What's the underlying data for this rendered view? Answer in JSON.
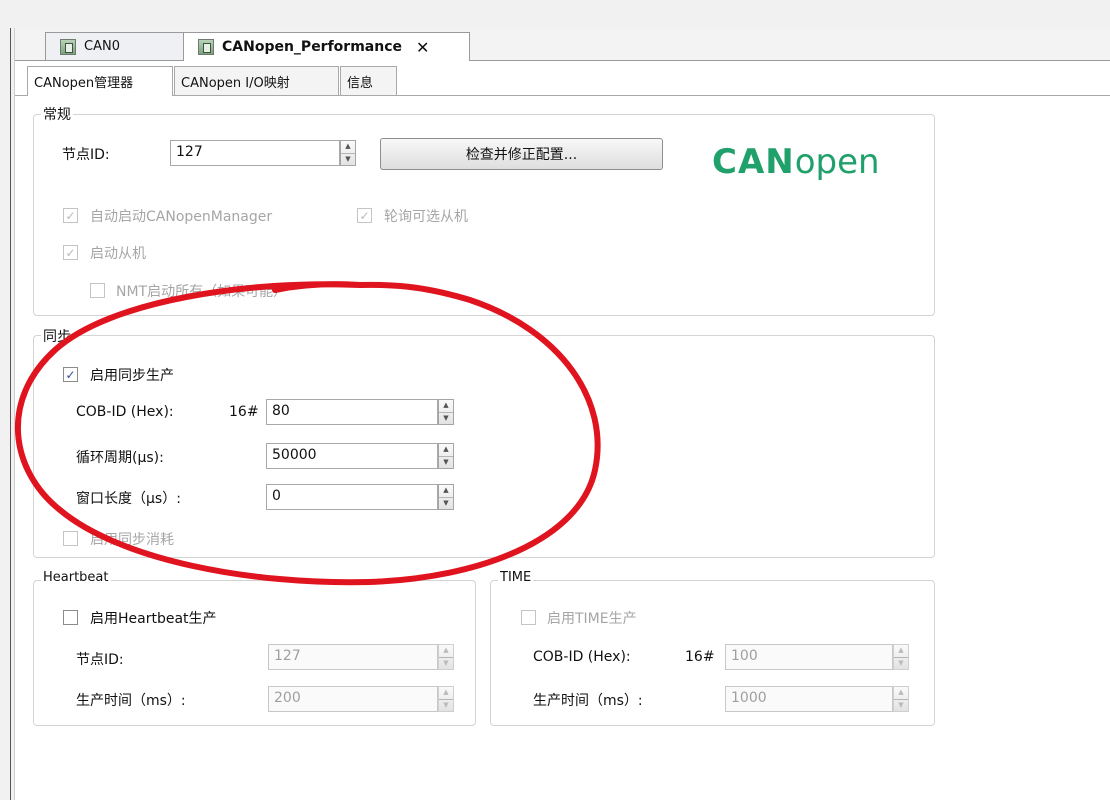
{
  "editor_tabs": [
    {
      "label": "CAN0"
    },
    {
      "label": "CANopen_Performance",
      "close": "✕"
    }
  ],
  "sub_tabs": [
    "CANopen管理器",
    "CANopen I/O映射",
    "信息"
  ],
  "general": {
    "title": "常规",
    "node_id_label": "节点ID:",
    "node_id_value": "127",
    "check_button": "检查并修正配置...",
    "auto_start_label": "自动启动CANopenManager",
    "poll_optional_label": "轮询可选从机",
    "start_slaves_label": "启动从机",
    "nmt_start_all_label": "NMT启动所有（如果可能）",
    "logo_can": "CAN",
    "logo_open": "open"
  },
  "sync": {
    "title": "同步",
    "enable_producer_label": "启用同步生产",
    "cob_id_label": "COB-ID (Hex):",
    "cob_id_prefix": "16#",
    "cob_id_value": "80",
    "cycle_label": "循环周期(μs):",
    "cycle_value": "50000",
    "window_label": "窗口长度（μs）:",
    "window_value": "0",
    "enable_consumer_label": "启用同步消耗"
  },
  "heartbeat": {
    "title": "Heartbeat",
    "enable_label": "启用Heartbeat生产",
    "node_id_label": "节点ID:",
    "node_id_value": "127",
    "producer_time_label": "生产时间（ms）:",
    "producer_time_value": "200"
  },
  "time": {
    "title": "TIME",
    "enable_label": "启用TIME生产",
    "cob_id_label": "COB-ID (Hex):",
    "cob_id_prefix": "16#",
    "cob_id_value": "100",
    "producer_time_label": "生产时间（ms）:",
    "producer_time_value": "1000"
  },
  "check_mark": "✓",
  "spin_up": "▲",
  "spin_down": "▼",
  "colors": {
    "annotation": "#e0141e",
    "logo": "#20a06a"
  }
}
